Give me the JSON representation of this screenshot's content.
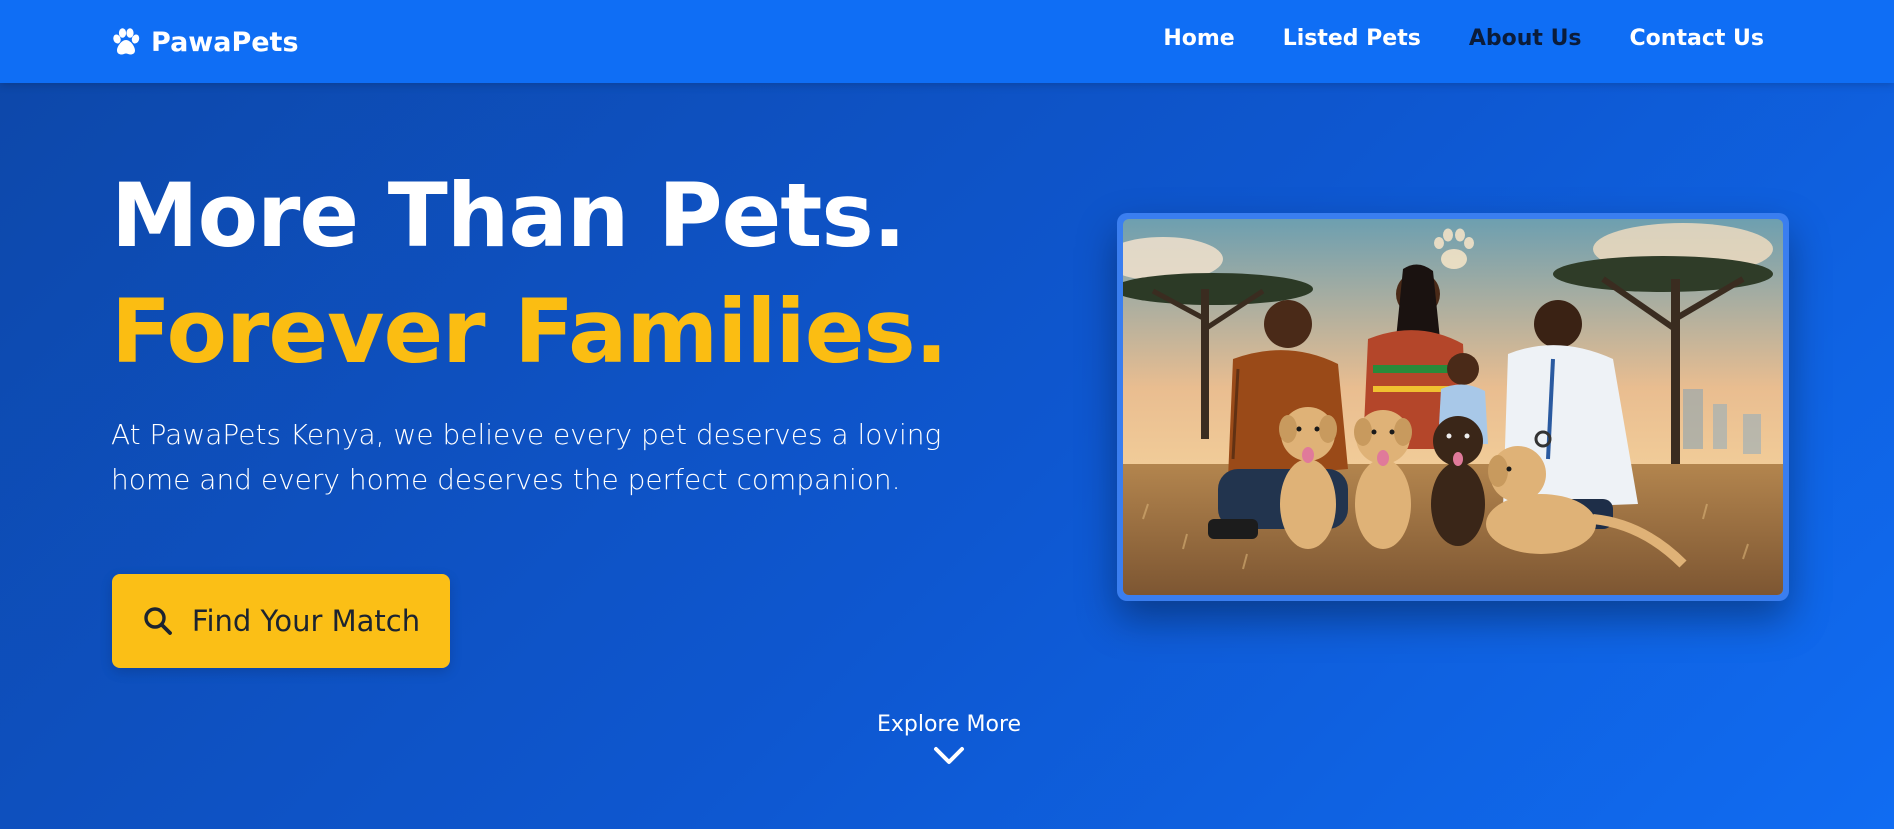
{
  "navbar": {
    "brand": "PawaPets",
    "links": [
      {
        "label": "Home"
      },
      {
        "label": "Listed Pets"
      },
      {
        "label": "About Us"
      },
      {
        "label": "Contact Us"
      }
    ]
  },
  "hero": {
    "title_line1": "More Than Pets.",
    "title_line2": "Forever Families.",
    "description": "At PawaPets Kenya, we believe every pet deserves a loving home and every home deserves the perfect companion.",
    "cta_label": "Find Your Match",
    "explore_label": "Explore More"
  },
  "icons": {
    "brand": "paw-icon",
    "cta": "search-icon",
    "explore": "chevron-down-icon"
  },
  "colors": {
    "navbar": "#0f6ef5",
    "accent": "#fbbd12",
    "active_link": "#0b1c3a"
  }
}
